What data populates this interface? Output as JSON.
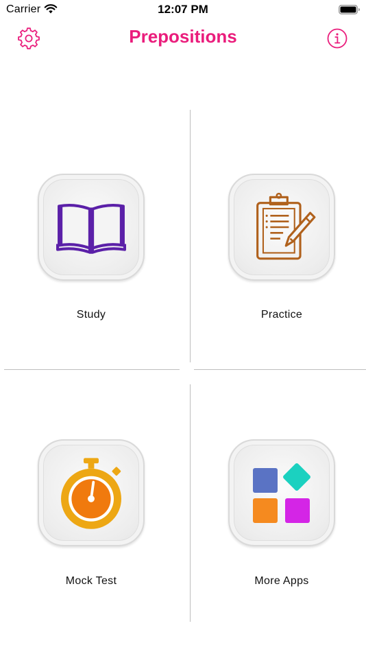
{
  "status_bar": {
    "carrier": "Carrier",
    "time": "12:07 PM"
  },
  "nav": {
    "title": "Prepositions",
    "settings_icon": "gear-icon",
    "info_icon": "info-circle-icon",
    "accent_color": "#ea1d7c"
  },
  "tiles": [
    {
      "label": "Study",
      "icon": "open-book-icon",
      "color": "#5b20a8"
    },
    {
      "label": "Practice",
      "icon": "clipboard-pen-icon",
      "color": "#b0611c"
    },
    {
      "label": "Mock Test",
      "icon": "stopwatch-icon",
      "color": "#f07a0e"
    },
    {
      "label": "More Apps",
      "icon": "app-grid-icon",
      "color": "#5a73c4"
    }
  ]
}
